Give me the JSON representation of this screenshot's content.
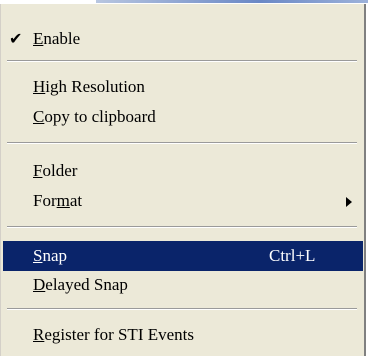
{
  "menu": {
    "items": [
      {
        "label": "Enable",
        "checked": true,
        "mnemonic": "E"
      },
      {
        "label": "High Resolution",
        "mnemonic": "H"
      },
      {
        "label": "Copy to clipboard",
        "mnemonic": "C"
      },
      {
        "label": "Folder",
        "mnemonic": "F"
      },
      {
        "label": "Format",
        "mnemonic": "m",
        "submenu": true
      },
      {
        "label": "Snap",
        "shortcut": "Ctrl+L",
        "mnemonic": "S",
        "selected": true
      },
      {
        "label": "Delayed Snap",
        "mnemonic": "D"
      },
      {
        "label": "Register for STI Events",
        "mnemonic": "R"
      }
    ],
    "check_glyph": "✔",
    "colors": {
      "menu_bg": "#ece9d8",
      "highlight_bg": "#0a246a",
      "highlight_text": "#ffffff"
    }
  }
}
